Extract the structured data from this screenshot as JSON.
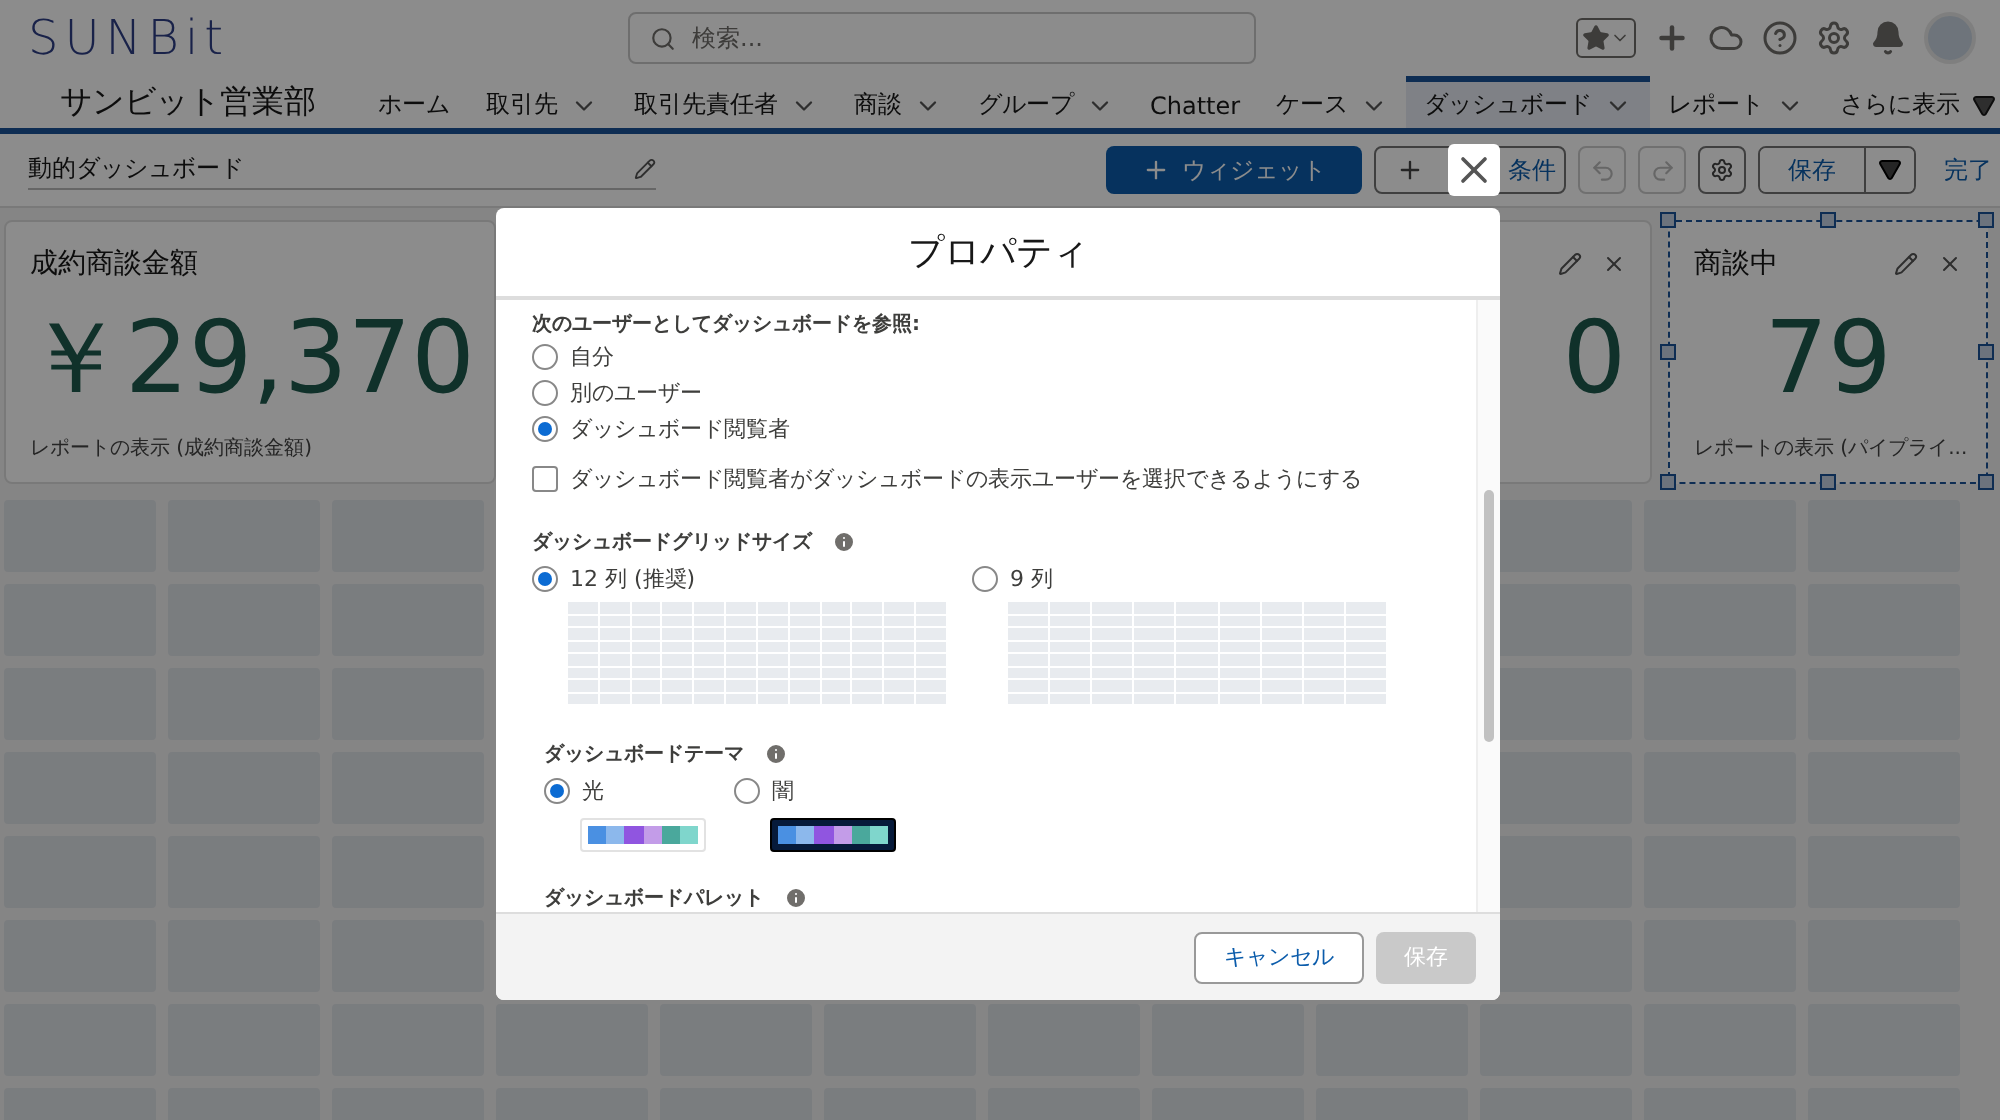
{
  "header": {
    "logo": "SUNBit",
    "search": {
      "placeholder": "検索..."
    }
  },
  "nav": {
    "app_name": "サンビット営業部",
    "items": [
      {
        "label": "ホーム",
        "selected": false,
        "has_menu": false
      },
      {
        "label": "取引先",
        "selected": false,
        "has_menu": true
      },
      {
        "label": "取引先責任者",
        "selected": false,
        "has_menu": true
      },
      {
        "label": "商談",
        "selected": false,
        "has_menu": true
      },
      {
        "label": "グループ",
        "selected": false,
        "has_menu": true
      },
      {
        "label": "Chatter",
        "selected": false,
        "has_menu": false
      },
      {
        "label": "ケース",
        "selected": false,
        "has_menu": true
      },
      {
        "label": "ダッシュボード",
        "selected": true,
        "has_menu": true
      },
      {
        "label": "レポート",
        "selected": false,
        "has_menu": true
      }
    ],
    "more": "さらに表示"
  },
  "toolbar": {
    "title": "動的ダッシュボード",
    "widget_button": "ウィジェット",
    "filter_button": "条件",
    "save_button": "保存",
    "done_link": "完了"
  },
  "cards": [
    {
      "title": "成約商談金額",
      "value": "￥29,370",
      "footer": "レポートの表示 (成約商談金額)",
      "selected": false
    },
    {
      "value": "0",
      "selected": false
    },
    {
      "title": "商談中",
      "value": "79",
      "footer": "レポートの表示 (パイプライ...",
      "selected": true
    }
  ],
  "modal": {
    "title": "プロパティ",
    "view_as": {
      "label": "次のユーザーとしてダッシュボードを参照:",
      "options": [
        {
          "label": "自分",
          "selected": false
        },
        {
          "label": "別のユーザー",
          "selected": false
        },
        {
          "label": "ダッシュボード閲覧者",
          "selected": true
        }
      ]
    },
    "viewer_choice": {
      "label": "ダッシュボード閲覧者がダッシュボードの表示ユーザーを選択できるようにする",
      "checked": false
    },
    "grid_size": {
      "label": "ダッシュボードグリッドサイズ",
      "options": [
        {
          "label": "12 列 (推奨)",
          "selected": true
        },
        {
          "label": "9 列",
          "selected": false
        }
      ]
    },
    "theme": {
      "label": "ダッシュボードテーマ",
      "options": [
        {
          "label": "光",
          "selected": true,
          "kind": "light"
        },
        {
          "label": "闇",
          "selected": false,
          "kind": "dark"
        }
      ]
    },
    "palette": {
      "label": "ダッシュボードパレット"
    },
    "cancel_button": "キャンセル",
    "save_button": {
      "label": "保存",
      "disabled": true
    }
  }
}
